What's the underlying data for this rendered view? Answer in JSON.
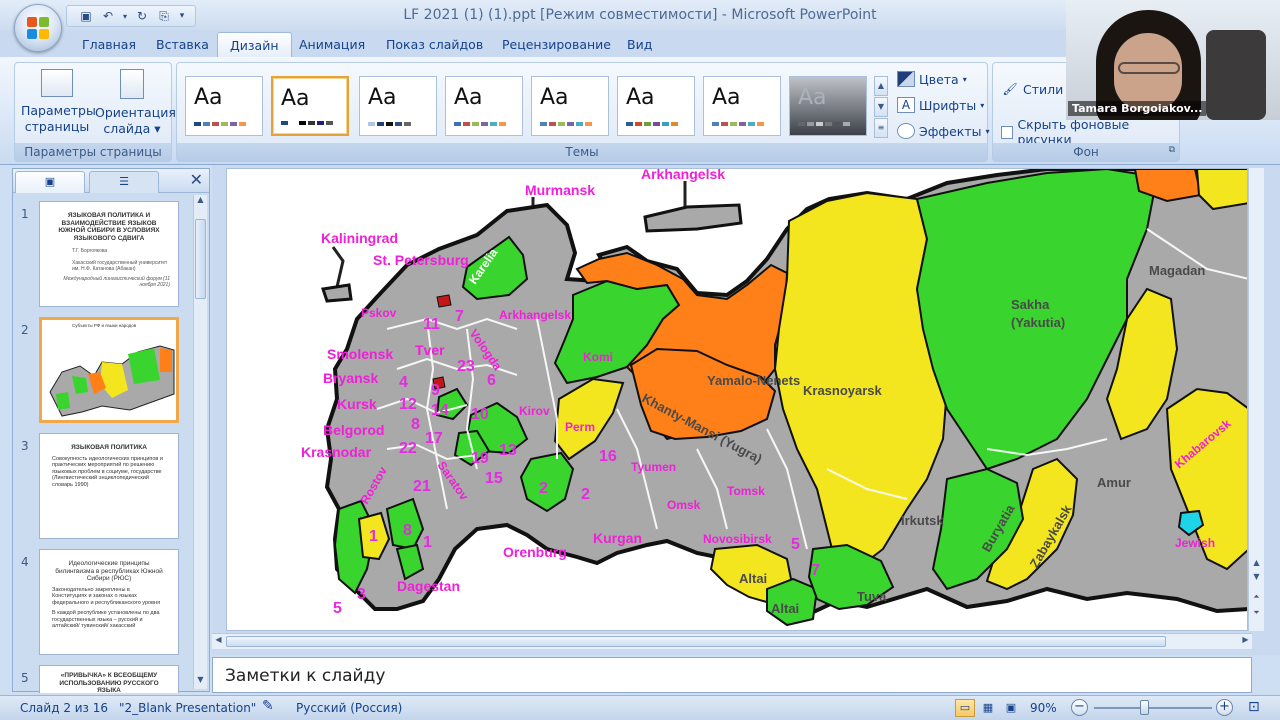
{
  "window": {
    "title": "LF 2021 (1) (1).ppt [Режим совместимости] - Microsoft PowerPoint"
  },
  "ribbon_tabs": [
    "Главная",
    "Вставка",
    "Дизайн",
    "Анимация",
    "Показ слайдов",
    "Рецензирование",
    "Вид"
  ],
  "active_tab": "Дизайн",
  "ribbon": {
    "page_setup": {
      "label": "Параметры страницы",
      "btn1_line1": "Параметры",
      "btn1_line2": "страницы",
      "btn2_line1": "Ориентация",
      "btn2_line2": "слайда ▾"
    },
    "themes": {
      "label": "Темы",
      "sample": "Aa",
      "colors": "Цвета",
      "fonts": "Шрифты",
      "effects": "Эффекты",
      "fonts_icon_letter": "A"
    },
    "background": {
      "label": "Фон",
      "styles": "Стили ф",
      "hide": "Скрыть фоновые рисунки"
    }
  },
  "webcam": {
    "name": "Tamara Borgoiakov..."
  },
  "slides": [
    {
      "num": "1",
      "title": "ЯЗЫКОВАЯ ПОЛИТИКА И ВЗАИМОДЕЙСТВИЕ ЯЗЫКОВ ЮЖНОЙ СИБИРИ В УСЛОВИЯХ ЯЗЫКОВОГО СДВИГА",
      "author": "Т.Г. Боргоякова",
      "affil": "Хакасский государственный университет им. Н.Ф. Катанова (Абакан)",
      "note": "Международный лингвистический форум (11 ноября 2021)"
    },
    {
      "num": "2",
      "caption": "Субъекты РФ и языки народов"
    },
    {
      "num": "3",
      "title": "ЯЗЫКОВАЯ ПОЛИТИКА",
      "body": "Совокупность идеологических принципов и практических мероприятий по решению языковых проблем в социуме, государстве (Лингвистический энциклопедический словарь 1990)"
    },
    {
      "num": "4",
      "title": "Идеологические принципы билингвизма в республиках Южной Сибири (РЮС)",
      "b1": "Законодательно закреплены в Конституциях и законах о языках федерального и республиканского уровня",
      "b2": "В каждой республике установлены по два государственных языка – русский и алтайский/ тувинский/ хакасский"
    },
    {
      "num": "5",
      "title": "«ПРИВЫЧКА» К ВСЕОБЩЕМУ ИСПОЛЬЗОВАНИЮ РУССКОГО ЯЗЫКА"
    }
  ],
  "map": {
    "labels": {
      "murmansk": "Murmansk",
      "arkhangelsk_top": "Arkhangelsk",
      "kaliningrad": "Kaliningrad",
      "spb": "St. Petersburg",
      "karelia": "Karelia",
      "pskov": "Pskov",
      "smolensk": "Smolensk",
      "bryansk": "Bryansk",
      "kursk": "Kursk",
      "belgorod": "Belgorod",
      "krasnodar": "Krasnodar",
      "tver": "Tver",
      "vologda": "Vologda",
      "arkhangelsk": "Arkhangelsk",
      "komi": "Komi",
      "kirov": "Kirov",
      "perm": "Perm",
      "saratov": "Saratov",
      "rostov": "Rostov",
      "orenburg": "Orenburg",
      "kurgan": "Kurgan",
      "tyumen": "Tyumen",
      "omsk": "Omsk",
      "novosibirsk": "Novosibirsk",
      "tomsk": "Tomsk",
      "altai": "Altai",
      "altai2": "Altai",
      "tuva": "Tuva",
      "yamalo": "Yamalo-Nenets",
      "khanty": "Khanty-Mansi (Yugra)",
      "krasnoyarsk": "Krasnoyarsk",
      "irkutsk": "Irkutsk",
      "buryatia": "Buryatia",
      "zabaykalsk": "Zabaykalsk",
      "amur": "Amur",
      "sakha": "Sakha",
      "yakutia": "(Yakutia)",
      "magadan": "Magadan",
      "khabarovsk": "Khabarovsk",
      "jewish": "Jewish",
      "dagestan": "Dagestan"
    },
    "numbers": [
      "11",
      "7",
      "23",
      "6",
      "4",
      "9",
      "14",
      "12",
      "10",
      "8",
      "17",
      "22",
      "19",
      "13",
      "15",
      "21",
      "16",
      "2",
      "2",
      "1",
      "8",
      "1",
      "5",
      "7",
      "3",
      "5"
    ]
  },
  "notes": {
    "placeholder": "Заметки к слайду"
  },
  "status": {
    "slide": "Слайд 2 из 16",
    "theme": "\"2_Blank Presentation\"",
    "language": "Русский (Россия)",
    "zoom": "90%"
  }
}
